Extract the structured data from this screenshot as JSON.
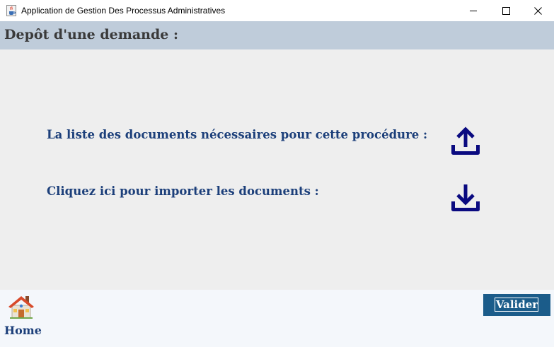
{
  "window": {
    "title": "Application de Gestion Des Processus Administratives",
    "icon": "java-cup-icon",
    "controls": {
      "minimize_icon": "minimize-icon",
      "maximize_icon": "maximize-icon",
      "close_icon": "close-icon"
    }
  },
  "header": {
    "title": "Depôt d'une demande :",
    "background": "#bfccda"
  },
  "main": {
    "background": "#eeeeee",
    "rows": [
      {
        "label": "La liste des documents nécessaires pour cette procédure :",
        "icon": "upload-icon"
      },
      {
        "label": "Cliquez ici pour importer les documents :",
        "icon": "download-icon"
      }
    ],
    "label_color": "#1c3f7a",
    "icon_color": "#0a0a80"
  },
  "footer": {
    "home_label": "Home",
    "home_icon": "house-icon",
    "submit_label": "Valider",
    "submit_color": "#1b5c8a"
  }
}
